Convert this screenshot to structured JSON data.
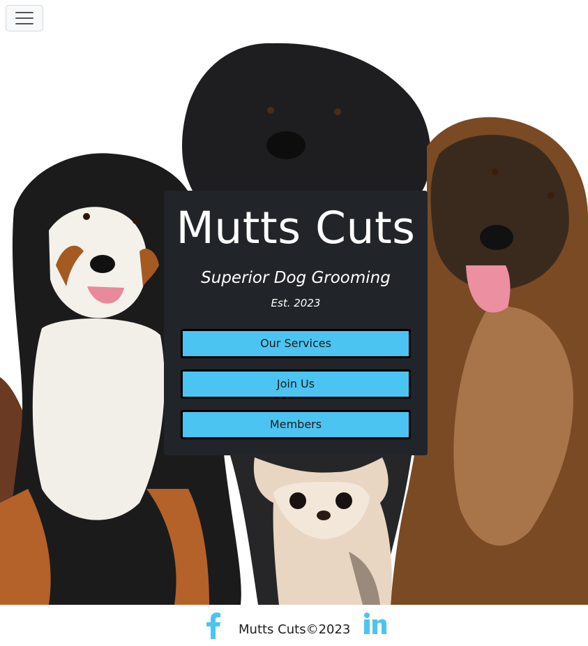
{
  "nav": {
    "toggle_icon": "hamburger-menu-icon"
  },
  "hero": {
    "image_subject": "dog-group-photo",
    "title": "Mutts Cuts",
    "tagline": "Superior Dog Grooming",
    "established": "Est. 2023",
    "buttons": [
      {
        "label": "Our Services"
      },
      {
        "label": "Join Us"
      },
      {
        "label": "Members"
      }
    ]
  },
  "footer": {
    "text": "Mutts Cuts©2023",
    "social_icons": [
      "facebook-icon",
      "linkedin-icon"
    ]
  },
  "colors": {
    "accent": "#4cc4f2",
    "card_bg": "#212529",
    "icon": "#4cc4f2"
  }
}
